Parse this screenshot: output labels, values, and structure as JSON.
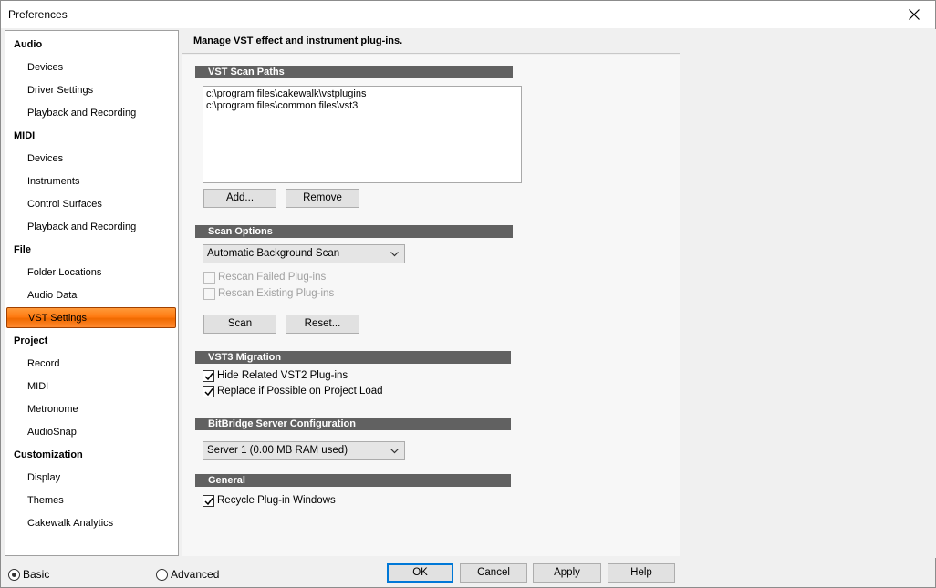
{
  "window": {
    "title": "Preferences"
  },
  "sidebar": {
    "categories": [
      {
        "label": "Audio",
        "items": [
          "Devices",
          "Driver Settings",
          "Playback and Recording"
        ]
      },
      {
        "label": "MIDI",
        "items": [
          "Devices",
          "Instruments",
          "Control Surfaces",
          "Playback and Recording"
        ]
      },
      {
        "label": "File",
        "items": [
          "Folder Locations",
          "Audio Data",
          "VST Settings"
        ]
      },
      {
        "label": "Project",
        "items": [
          "Record",
          "MIDI",
          "Metronome",
          "AudioSnap"
        ]
      },
      {
        "label": "Customization",
        "items": [
          "Display",
          "Themes",
          "Cakewalk Analytics"
        ]
      }
    ],
    "selected": "VST Settings"
  },
  "main": {
    "header": "Manage VST effect and instrument plug-ins.",
    "scan_paths": {
      "title": "VST Scan Paths",
      "paths": [
        "c:\\program files\\cakewalk\\vstplugins",
        "c:\\program files\\common files\\vst3"
      ],
      "add_label": "Add...",
      "remove_label": "Remove"
    },
    "scan_options": {
      "title": "Scan Options",
      "mode": "Automatic Background Scan",
      "rescan_failed": {
        "label": "Rescan Failed Plug-ins",
        "checked": false,
        "enabled": false
      },
      "rescan_existing": {
        "label": "Rescan Existing Plug-ins",
        "checked": false,
        "enabled": false
      },
      "scan_label": "Scan",
      "reset_label": "Reset..."
    },
    "vst3_migration": {
      "title": "VST3 Migration",
      "hide_vst2": {
        "label": "Hide Related VST2 Plug-ins",
        "checked": true
      },
      "replace_on_load": {
        "label": "Replace if Possible on Project Load",
        "checked": true
      }
    },
    "bitbridge": {
      "title": "BitBridge Server Configuration",
      "server": "Server 1  (0.00  MB RAM used)"
    },
    "general": {
      "title": "General",
      "recycle": {
        "label": "Recycle Plug-in Windows",
        "checked": true
      }
    }
  },
  "footer": {
    "basic_label": "Basic",
    "advanced_label": "Advanced",
    "selected_mode": "Basic",
    "ok_label": "OK",
    "cancel_label": "Cancel",
    "apply_label": "Apply",
    "help_label": "Help"
  },
  "colors": {
    "selection_orange": "#ff7b12",
    "section_bar": "#616161",
    "default_button_border": "#0078d7"
  }
}
